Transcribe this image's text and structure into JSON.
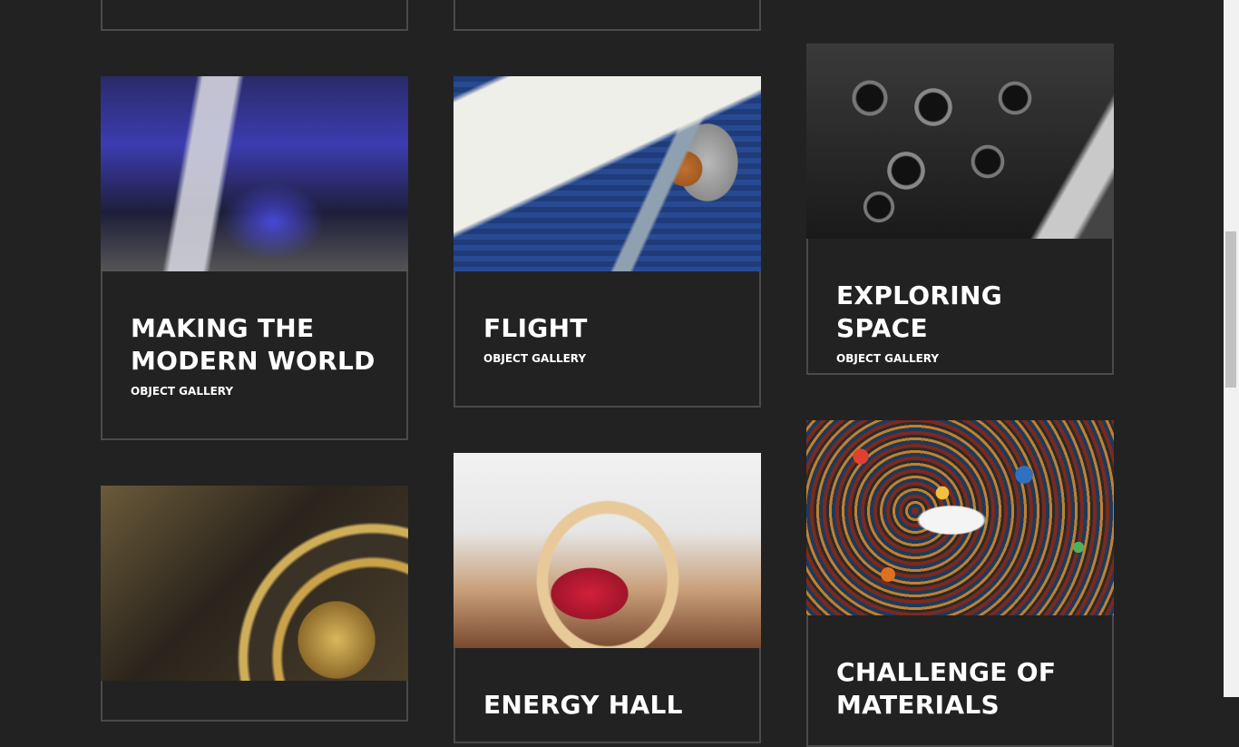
{
  "cards": [
    {
      "title": "",
      "subtitle": "",
      "image": "partial-card-top-left"
    },
    {
      "title": "",
      "subtitle": "",
      "image": "partial-card-top-middle"
    },
    {
      "title": "MAKING THE MODERN WORLD",
      "subtitle": "OBJECT GALLERY",
      "image": "aircraft-and-cars-gallery"
    },
    {
      "title": "FLIGHT",
      "subtitle": "OBJECT GALLERY",
      "image": "biplane-propeller"
    },
    {
      "title": "EXPLORING SPACE",
      "subtitle": "OBJECT GALLERY",
      "image": "rocket-engines"
    },
    {
      "title": "",
      "subtitle": "",
      "image": "astronomical-clock"
    },
    {
      "title": "ENERGY HALL",
      "subtitle": "",
      "image": "steam-engine-hall"
    },
    {
      "title": "CHALLENGE OF MATERIALS",
      "subtitle": "",
      "image": "colorful-material-swirl"
    }
  ],
  "colors": {
    "background": "#222222",
    "border": "#4a4a4a",
    "text": "#ffffff"
  }
}
